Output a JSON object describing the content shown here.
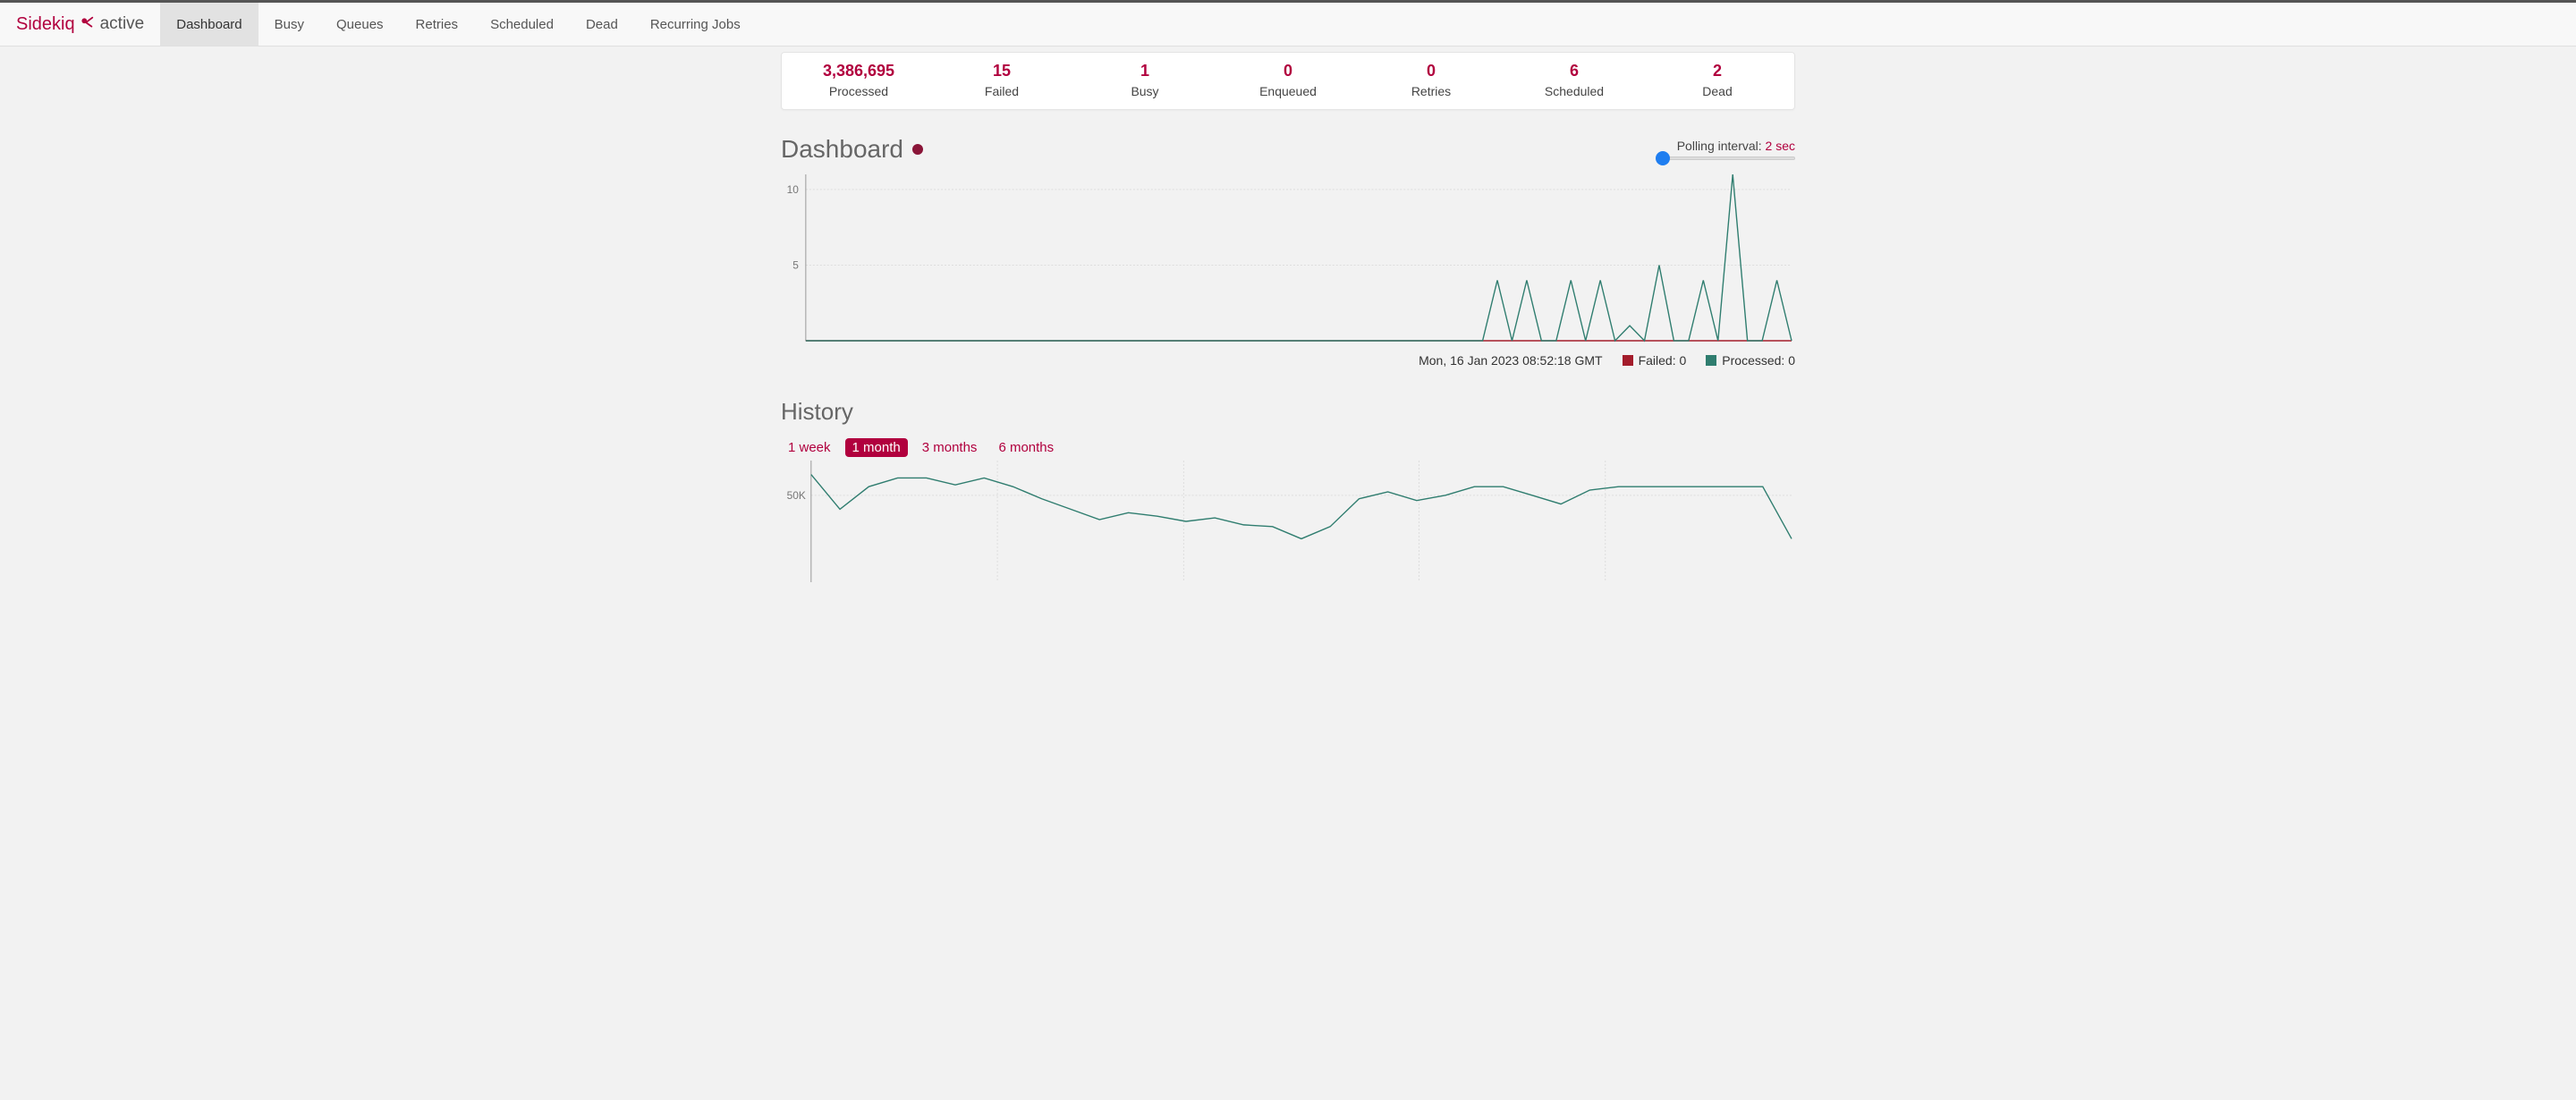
{
  "brand": {
    "name": "Sidekiq",
    "status": "active"
  },
  "nav": {
    "tabs": [
      {
        "label": "Dashboard",
        "active": true
      },
      {
        "label": "Busy"
      },
      {
        "label": "Queues"
      },
      {
        "label": "Retries"
      },
      {
        "label": "Scheduled"
      },
      {
        "label": "Dead"
      },
      {
        "label": "Recurring Jobs"
      }
    ]
  },
  "stats": [
    {
      "value": "3,386,695",
      "label": "Processed"
    },
    {
      "value": "15",
      "label": "Failed"
    },
    {
      "value": "1",
      "label": "Busy"
    },
    {
      "value": "0",
      "label": "Enqueued"
    },
    {
      "value": "0",
      "label": "Retries"
    },
    {
      "value": "6",
      "label": "Scheduled"
    },
    {
      "value": "2",
      "label": "Dead"
    }
  ],
  "dashboard": {
    "title": "Dashboard",
    "polling_label": "Polling interval:",
    "polling_value": "2 sec",
    "timestamp": "Mon, 16 Jan 2023 08:52:18 GMT",
    "legend_failed": "Failed: 0",
    "legend_processed": "Processed: 0"
  },
  "history": {
    "title": "History",
    "ranges": [
      {
        "label": "1 week"
      },
      {
        "label": "1 month",
        "active": true
      },
      {
        "label": "3 months"
      },
      {
        "label": "6 months"
      }
    ],
    "ylabel": "50K"
  },
  "chart_data": [
    {
      "type": "line",
      "title": "Realtime",
      "ylabel": "",
      "xlabel": "",
      "ylim": [
        0,
        11
      ],
      "yticks": [
        5,
        10
      ],
      "series": [
        {
          "name": "Processed",
          "values": [
            0,
            0,
            0,
            0,
            0,
            0,
            0,
            0,
            0,
            0,
            0,
            0,
            0,
            0,
            0,
            0,
            0,
            0,
            0,
            0,
            0,
            0,
            0,
            0,
            0,
            0,
            0,
            0,
            0,
            0,
            0,
            0,
            0,
            0,
            0,
            0,
            0,
            0,
            0,
            0,
            0,
            0,
            0,
            0,
            0,
            0,
            0,
            4,
            0,
            4,
            0,
            0,
            4,
            0,
            4,
            0,
            1,
            0,
            5,
            0,
            0,
            4,
            0,
            11,
            0,
            0,
            4,
            0
          ]
        },
        {
          "name": "Failed",
          "values": [
            0,
            0,
            0,
            0,
            0,
            0,
            0,
            0,
            0,
            0,
            0,
            0,
            0,
            0,
            0,
            0,
            0,
            0,
            0,
            0,
            0,
            0,
            0,
            0,
            0,
            0,
            0,
            0,
            0,
            0,
            0,
            0,
            0,
            0,
            0,
            0,
            0,
            0,
            0,
            0,
            0,
            0,
            0,
            0,
            0,
            0,
            0,
            0,
            0,
            0,
            0,
            0,
            0,
            0,
            0,
            0,
            0,
            0,
            0,
            0,
            0,
            0,
            0,
            0,
            0,
            0,
            0,
            0
          ]
        }
      ]
    },
    {
      "type": "line",
      "title": "History",
      "ylabel": "",
      "xlabel": "",
      "ylim": [
        0,
        70000
      ],
      "yticks": [
        50000
      ],
      "series": [
        {
          "name": "Processed",
          "values": [
            62000,
            42000,
            55000,
            60000,
            60000,
            56000,
            60000,
            55000,
            48000,
            42000,
            36000,
            40000,
            38000,
            35000,
            37000,
            33000,
            32000,
            25000,
            32000,
            48000,
            52000,
            47000,
            50000,
            55000,
            55000,
            50000,
            45000,
            53000,
            55000,
            55000,
            55000,
            55000,
            55000,
            55000,
            25000
          ]
        }
      ]
    }
  ]
}
